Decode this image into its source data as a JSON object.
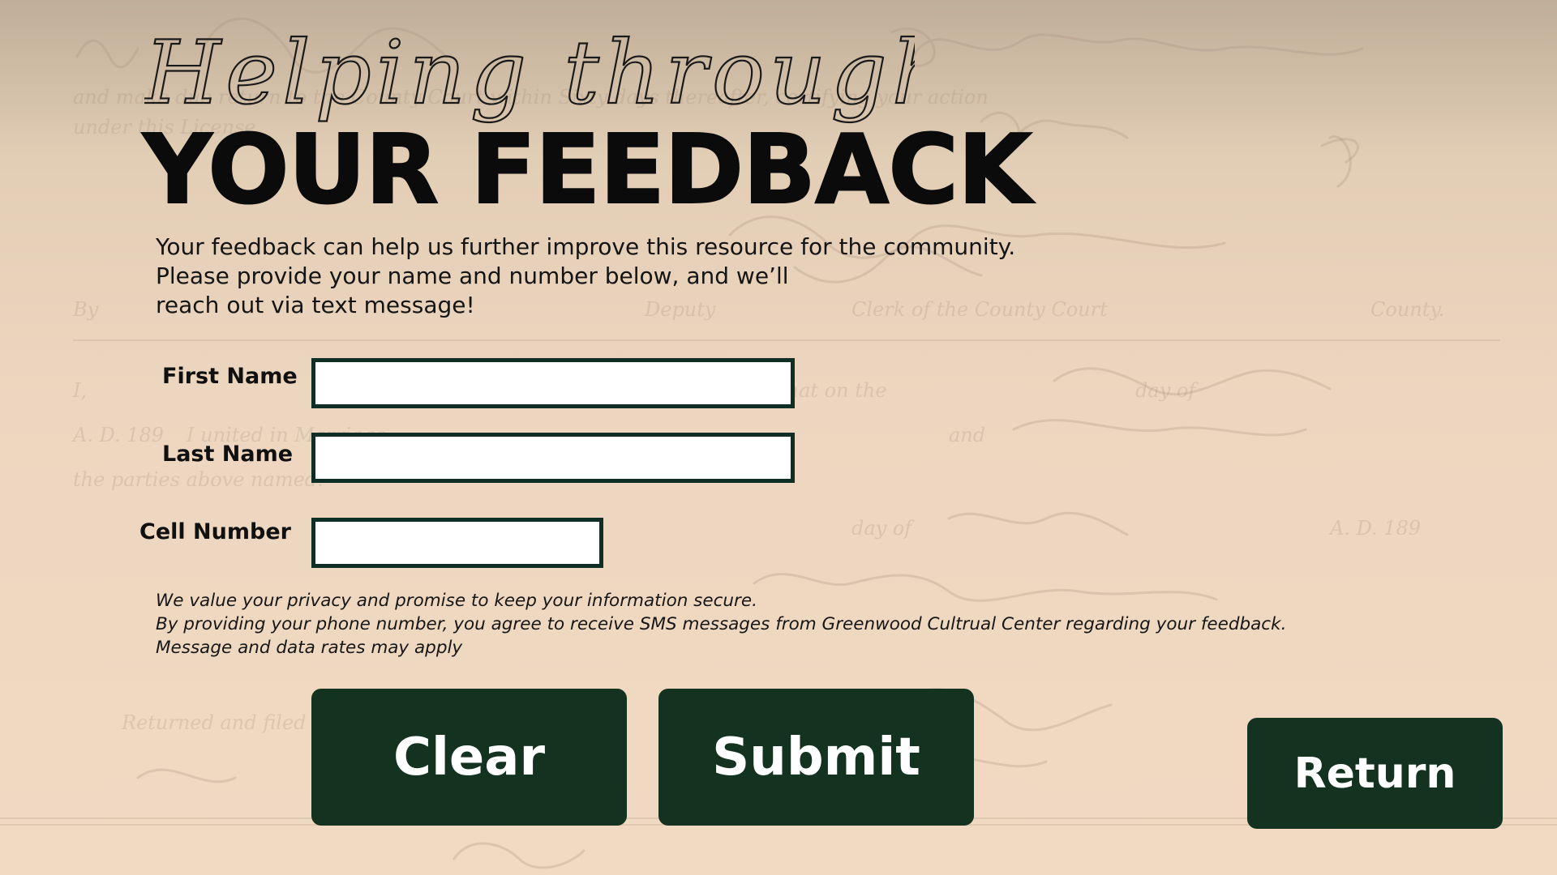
{
  "header": {
    "script_title": "Helping through",
    "main_title": "YOUR FEEDBACK"
  },
  "intro": {
    "line1": "Your feedback can help us further improve this resource for the community.",
    "line2": "Please provide your name and number below, and we’ll",
    "line3": "reach out via text message!"
  },
  "form": {
    "first_name": {
      "label": "First Name",
      "value": ""
    },
    "last_name": {
      "label": "Last Name",
      "value": ""
    },
    "cell_number": {
      "label": "Cell Number",
      "value": ""
    }
  },
  "privacy": {
    "line1": "We value your privacy and promise to keep your information secure.",
    "line2": "By providing your phone number, you agree to receive SMS messages from Greenwood Cultrual Center regarding your feedback.",
    "line3": "Message and data rates may apply"
  },
  "buttons": {
    "clear": "Clear",
    "submit": "Submit",
    "return": "Return"
  },
  "colors": {
    "button_bg": "#133220",
    "input_border": "#0f2e26",
    "background": "#edd6bf"
  }
}
